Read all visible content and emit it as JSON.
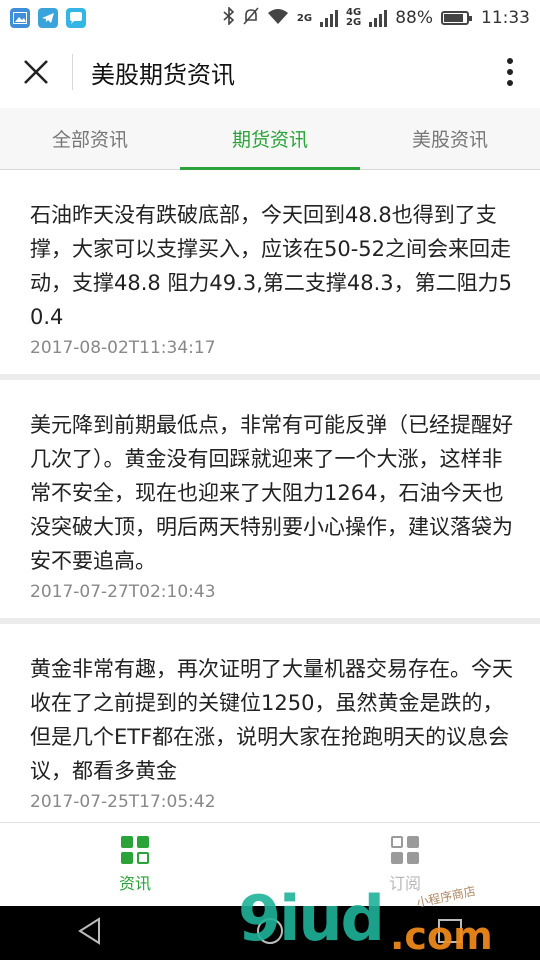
{
  "status_bar": {
    "time": "11:33",
    "battery_percent": "88%",
    "network_labels": [
      "2G",
      "4G",
      "2G"
    ],
    "battery_level": 0.88
  },
  "header": {
    "title": "美股期货资讯",
    "close_icon": "close-icon",
    "more_icon": "more-vertical-icon"
  },
  "tabs": [
    {
      "label": "全部资讯",
      "active": false
    },
    {
      "label": "期货资讯",
      "active": true
    },
    {
      "label": "美股资讯",
      "active": false
    }
  ],
  "articles": [
    {
      "text": "石油昨天没有跌破底部，今天回到48.8也得到了支撑，大家可以支撑买入，应该在50-52之间会来回走动，支撑48.8 阻力49.3,第二支撑48.3，第二阻力50.4",
      "time": "2017-08-02T11:34:17"
    },
    {
      "text": "美元降到前期最低点，非常有可能反弹（已经提醒好几次了）。黄金没有回踩就迎来了一个大涨，这样非常不安全，现在也迎来了大阻力1264，石油今天也没突破大顶，明后两天特别要小心操作，建议落袋为安不要追高。",
      "time": "2017-07-27T02:10:43"
    },
    {
      "text": "黄金非常有趣，再次证明了大量机器交易存在。今天收在了之前提到的关键位1250，虽然黄金是跌的，但是几个ETF都在涨，说明大家在抢跑明天的议息会议，都看多黄金",
      "time": "2017-07-25T17:05:42"
    }
  ],
  "bottom_nav": [
    {
      "label": "资讯",
      "active": true
    },
    {
      "label": "订阅",
      "active": false
    }
  ],
  "watermark": {
    "text": "9iud",
    "suffix": ".com",
    "small": "小程序商店"
  },
  "colors": {
    "accent": "#2aa43a",
    "watermark_teal": "#1fb39a",
    "watermark_orange": "#f28c1b"
  }
}
